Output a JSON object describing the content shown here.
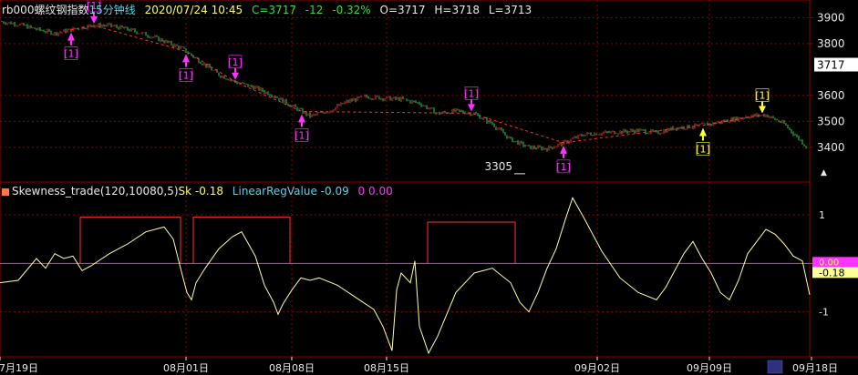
{
  "header": {
    "symbol": "rb000",
    "name": "螺纹钢指数",
    "period": "15分钟线",
    "datetime": "2020/07/24 10:45",
    "close_label": "C=3717",
    "change": "-12",
    "change_pct": "-0.32%",
    "open_label": "O=3717",
    "high_label": "H=3718",
    "low_label": "L=3713"
  },
  "price_axis": {
    "ticks": [
      "3900",
      "3800",
      "3717",
      "3600",
      "3500",
      "3400"
    ],
    "current": "3717",
    "low_annotation": "3305"
  },
  "signal_label": "[1]",
  "indicator": {
    "name": "Skewness_trade(120,10080,5)",
    "sk_label": "Sk -0.18",
    "lr_label": "LinearRegValue -0.09",
    "zero_label": "0 0.00",
    "axis_ticks": [
      "1",
      "0.00",
      "-0.18",
      "-1"
    ]
  },
  "date_axis": [
    "07月19日",
    "08月01日",
    "08月08日",
    "08月15日",
    "09月02日",
    "09月09日",
    "09月18日"
  ],
  "colors": {
    "bg": "#000000",
    "grid": "#8b0000",
    "up": "#ff3030",
    "down": "#30d060",
    "signal": "#ff33ff",
    "signal_alt": "#ffff33",
    "box": "#ff3030",
    "indicator": "#ffffa0",
    "zero": "#dd33dd"
  },
  "chart_data": [
    {
      "type": "line",
      "title": "rb000 螺纹钢指数 15分钟线",
      "ylim": [
        3280,
        3940
      ],
      "x_ticks": [
        "07月19日",
        "08月01日",
        "08月08日",
        "08月15日",
        "09月02日",
        "09月09日",
        "09月18日"
      ],
      "x": [
        0,
        20,
        40,
        60,
        80,
        100,
        120,
        140,
        160,
        180,
        200,
        220,
        240,
        260,
        280,
        300,
        320,
        340,
        360,
        380,
        400,
        420,
        440,
        460,
        480,
        500,
        520,
        540,
        560,
        580,
        600,
        620,
        640,
        660,
        680,
        700,
        720,
        740,
        760,
        780,
        800,
        820,
        840,
        860,
        885
      ],
      "y": [
        3885,
        3875,
        3855,
        3840,
        3855,
        3870,
        3870,
        3855,
        3835,
        3810,
        3780,
        3730,
        3680,
        3650,
        3630,
        3600,
        3560,
        3520,
        3540,
        3575,
        3595,
        3590,
        3585,
        3570,
        3530,
        3540,
        3530,
        3490,
        3430,
        3400,
        3395,
        3420,
        3450,
        3455,
        3460,
        3465,
        3455,
        3475,
        3480,
        3490,
        3505,
        3520,
        3525,
        3490,
        3400
      ],
      "signals": [
        {
          "x": 78,
          "direction": "up"
        },
        {
          "x": 103,
          "direction": "down"
        },
        {
          "x": 204,
          "direction": "up"
        },
        {
          "x": 258,
          "direction": "down"
        },
        {
          "x": 331,
          "direction": "up"
        },
        {
          "x": 517,
          "direction": "down"
        },
        {
          "x": 618,
          "direction": "up"
        },
        {
          "x": 771,
          "direction": "up"
        },
        {
          "x": 836,
          "direction": "down"
        }
      ]
    },
    {
      "type": "line",
      "title": "Skewness_trade(120,10080,5)",
      "ylim": [
        -1.85,
        1.3
      ],
      "reference_line": 0,
      "current_value": -0.18,
      "x": [
        0,
        20,
        40,
        50,
        60,
        70,
        80,
        90,
        100,
        120,
        140,
        160,
        180,
        190,
        198,
        205,
        210,
        215,
        225,
        240,
        255,
        265,
        280,
        290,
        300,
        305,
        310,
        320,
        330,
        340,
        350,
        370,
        390,
        410,
        420,
        430,
        435,
        440,
        450,
        455,
        460,
        470,
        480,
        500,
        520,
        540,
        560,
        570,
        580,
        590,
        600,
        610,
        620,
        628,
        640,
        660,
        680,
        700,
        720,
        730,
        740,
        750,
        760,
        770,
        780,
        790,
        800,
        810,
        820,
        830,
        840,
        850,
        860,
        870,
        880,
        888
      ],
      "y": [
        -0.4,
        -0.35,
        0.1,
        -0.1,
        0.2,
        0.1,
        0.15,
        -0.15,
        -0.05,
        0.2,
        0.4,
        0.65,
        0.75,
        0.5,
        -0.1,
        -0.6,
        -0.75,
        -0.4,
        -0.1,
        0.3,
        0.55,
        0.65,
        0.15,
        -0.45,
        -0.8,
        -1.05,
        -0.85,
        -0.55,
        -0.3,
        -0.35,
        -0.3,
        -0.45,
        -0.7,
        -0.95,
        -1.3,
        -1.8,
        -0.55,
        -0.2,
        -0.4,
        0.05,
        -1.3,
        -1.85,
        -1.5,
        -0.6,
        -0.2,
        -0.1,
        -0.4,
        -0.8,
        -1.0,
        -0.6,
        -0.1,
        0.3,
        0.9,
        1.35,
        0.95,
        0.25,
        -0.3,
        -0.6,
        -0.75,
        -0.5,
        -0.15,
        0.2,
        0.45,
        0.1,
        -0.2,
        -0.6,
        -0.75,
        -0.35,
        0.2,
        0.45,
        0.7,
        0.6,
        0.4,
        0.15,
        0.05,
        -0.65
      ]
    }
  ],
  "signal_boxes": [
    {
      "x_from": 88,
      "x_to": 198,
      "level": 0.95
    },
    {
      "x_from": 212,
      "x_to": 318,
      "level": 0.95
    },
    {
      "x_from": 469,
      "x_to": 565,
      "level": 0.85
    }
  ]
}
